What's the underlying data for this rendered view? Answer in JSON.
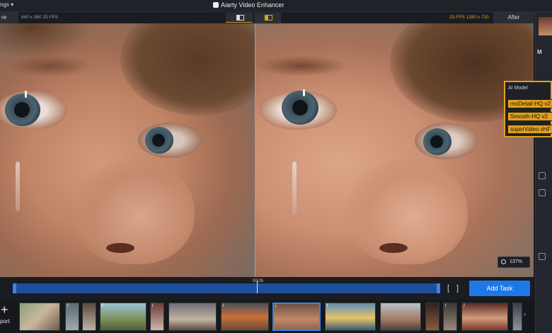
{
  "titlebar": {
    "menu_label": "ngs ▾",
    "app_title": "Aiarty Video Enhancer"
  },
  "preview_info": {
    "before_label": "re",
    "after_label": "After",
    "left_info": "640 x 360   25 FPS",
    "right_info": "25 FPS   1280 x 720"
  },
  "zoom": {
    "level": "137%"
  },
  "ai_model": {
    "header": "AI Model",
    "options": [
      "moDetail-HQ v2",
      "Smooth-HQ v2",
      "superVideo vHF"
    ]
  },
  "timeline": {
    "time": "00:05",
    "bracket_left": "[",
    "bracket_right": "]",
    "add_task_label": "Add Task"
  },
  "import": {
    "label": "port"
  },
  "colors": {
    "accent": "#e0a020",
    "primary": "#1f78e8",
    "timeline": "#1d4f9a"
  }
}
